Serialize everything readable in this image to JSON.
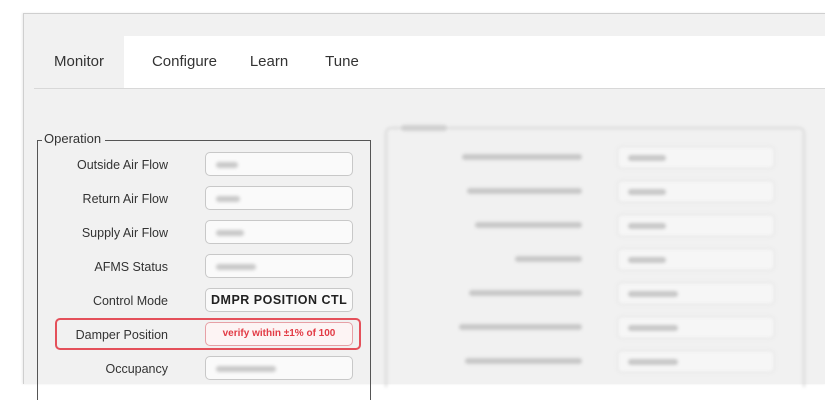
{
  "tabs": [
    {
      "label": "Monitor",
      "active": true
    },
    {
      "label": "Configure",
      "active": false
    },
    {
      "label": "Learn",
      "active": false
    },
    {
      "label": "Tune",
      "active": false
    }
  ],
  "operation": {
    "legend": "Operation",
    "rows": [
      {
        "label": "Outside Air Flow",
        "value": ""
      },
      {
        "label": "Return Air Flow",
        "value": ""
      },
      {
        "label": "Supply Air Flow",
        "value": ""
      },
      {
        "label": "AFMS Status",
        "value": ""
      },
      {
        "label": "Control Mode",
        "value": "DMPR POSITION CTL"
      },
      {
        "label": "Damper Position",
        "value": "verify within ±1% of 100"
      },
      {
        "label": "Occupancy",
        "value": ""
      }
    ]
  },
  "colors": {
    "highlight": "#e4505a",
    "warning_text": "#e23b45",
    "background": "#f1f1f1"
  }
}
